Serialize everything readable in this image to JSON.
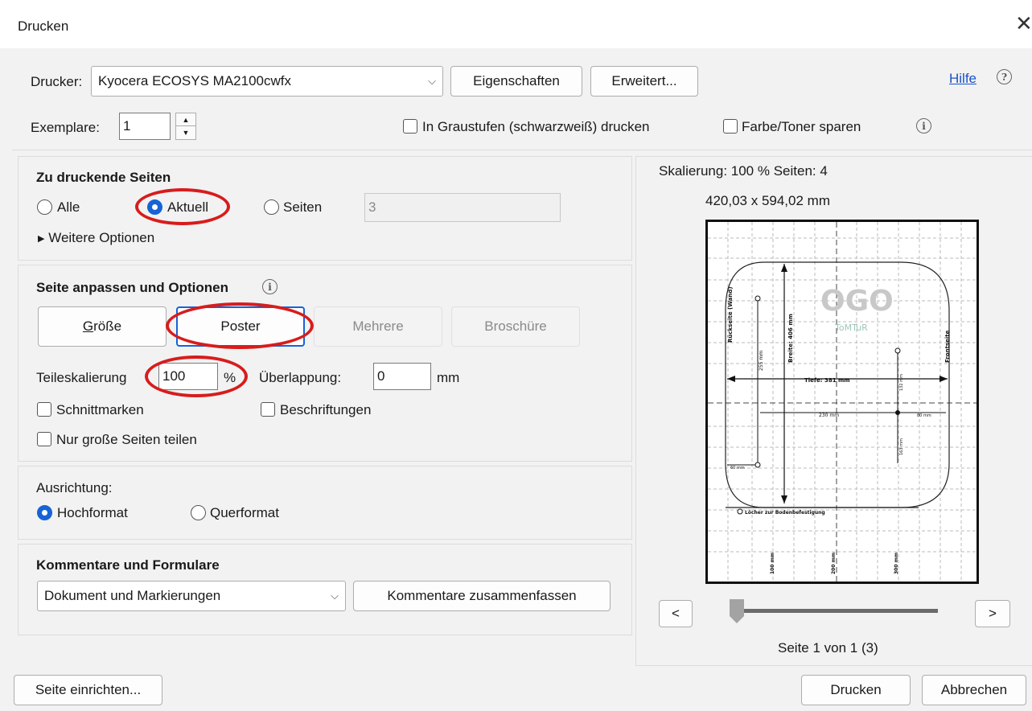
{
  "window": {
    "title": "Drucken",
    "close_icon": "close-icon"
  },
  "printer": {
    "label": "Drucker:",
    "selected": "Kyocera ECOSYS MA2100cwfx",
    "properties_button": "Eigenschaften",
    "advanced_button": "Erweitert...",
    "help_link": "Hilfe",
    "copies_label": "Exemplare:",
    "copies_value": "1",
    "grayscale_label": "In Graustufen (schwarzweiß) drucken",
    "save_toner_label": "Farbe/Toner sparen"
  },
  "pages": {
    "title": "Zu druckende Seiten",
    "all_label": "Alle",
    "current_label": "Aktuell",
    "pages_label": "Seiten",
    "pages_value": "3",
    "more_options": "Weitere Optionen",
    "selected": "current"
  },
  "sizing": {
    "title": "Seite anpassen und Optionen",
    "tabs": [
      "Größe",
      "Poster",
      "Mehrere",
      "Broschüre"
    ],
    "size_tab_underline": "G",
    "size_tab_rest": "röße",
    "active_tab": "Poster",
    "tile_scale_label": "Teileskalierung",
    "tile_scale_value": "100",
    "percent": "%",
    "overlap_label": "Überlappung:",
    "overlap_value": "0",
    "overlap_unit": "mm",
    "cut_marks_label": "Schnittmarken",
    "labels_label": "Beschriftungen",
    "large_pages_label": "Nur große Seiten teilen"
  },
  "orientation": {
    "title": "Ausrichtung:",
    "portrait_label": "Hochformat",
    "landscape_label": "Querformat",
    "selected": "portrait"
  },
  "comments": {
    "title": "Kommentare und Formulare",
    "selected": "Dokument und Markierungen",
    "summarize_button": "Kommentare zusammenfassen"
  },
  "preview": {
    "scaling_text": "Skalierung: 100 % Seiten: 4",
    "dimensions": "420,03 x 594,02 mm",
    "prev_button": "<",
    "next_button": ">",
    "page_info": "Seite 1 von 1 (3)",
    "slider_position": 0,
    "drawing": {
      "left_side": "Rückseite (Wand)",
      "right_side": "Frontseite",
      "width_label": "Breite: 406 mm",
      "depth_label": "Tiefe: 381 mm",
      "dim_255": "255 mm",
      "dim_230": "230 mm",
      "dim_80": "80 mm",
      "dim_132": "132 mm",
      "dim_163": "163 mm",
      "dim_60": "60 mm",
      "holes_label": "Löcher zur Bodenbefestigung",
      "ruler_100": "100 mm",
      "ruler_200": "200 mm",
      "ruler_300": "300 mm",
      "logo_text": "OGO",
      "logo_sub": "ToMTuR"
    }
  },
  "footer": {
    "page_setup_button": "Seite einrichten...",
    "print_button": "Drucken",
    "cancel_button": "Abbrechen"
  },
  "colors": {
    "accent": "#1763d6",
    "highlight": "#d81c1c",
    "link": "#1a53c7"
  }
}
